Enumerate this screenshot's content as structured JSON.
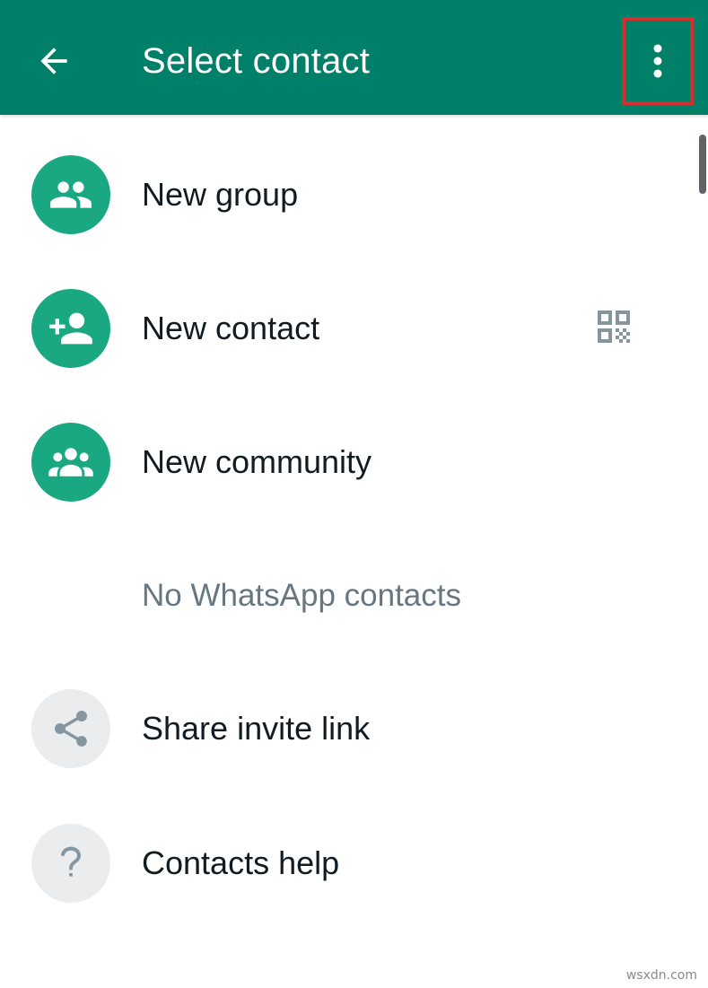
{
  "appbar": {
    "title": "Select contact",
    "back_icon": "arrow-left-icon",
    "more_icon": "more-vertical-icon",
    "highlight_color": "#d32f2f"
  },
  "colors": {
    "brand": "#008069",
    "avatar_green": "#1aa883",
    "avatar_grey": "#eaecee",
    "text_primary": "#111b21",
    "text_secondary": "#667781"
  },
  "actions": [
    {
      "label": "New group",
      "icon": "group-icon"
    },
    {
      "label": "New contact",
      "icon": "add-person-icon",
      "trailing_icon": "qr-code-icon"
    },
    {
      "label": "New community",
      "icon": "community-icon"
    }
  ],
  "contacts_note": "No WhatsApp contacts",
  "footer_actions": [
    {
      "label": "Share invite link",
      "icon": "share-icon"
    },
    {
      "label": "Contacts help",
      "icon": "help-icon"
    }
  ],
  "watermark": "wsxdn.com"
}
